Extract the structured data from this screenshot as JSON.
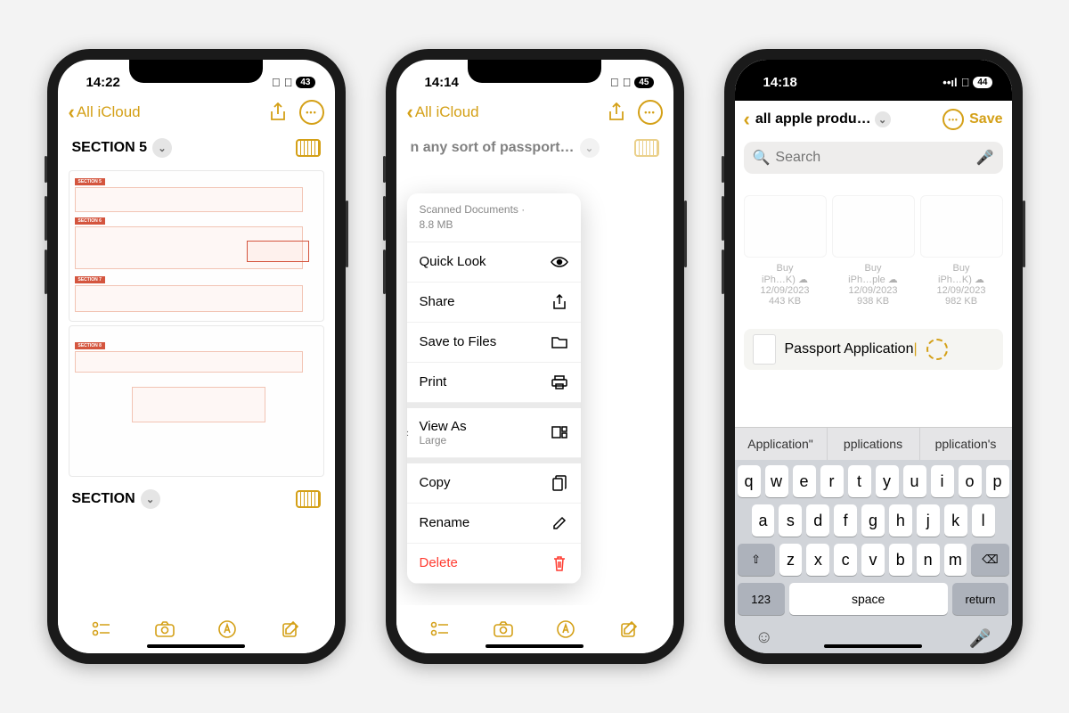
{
  "phone1": {
    "status": {
      "time": "14:22",
      "battery": "43"
    },
    "nav": {
      "back_label": "All iCloud"
    },
    "sections": [
      {
        "title": "SECTION 5"
      },
      {
        "title": "SECTION"
      }
    ]
  },
  "phone2": {
    "status": {
      "time": "14:14",
      "battery": "45"
    },
    "nav": {
      "back_label": "All iCloud"
    },
    "note_title": "n any sort of passport…",
    "popover": {
      "header_title": "Scanned Documents ·",
      "header_size": "8.8 MB",
      "items": [
        {
          "label": "Quick Look",
          "icon": "eye"
        },
        {
          "label": "Share",
          "icon": "share"
        },
        {
          "label": "Save to Files",
          "icon": "folder"
        },
        {
          "label": "Print",
          "icon": "printer"
        },
        {
          "label": "View As",
          "sub": "Large",
          "icon": "grid",
          "submenu": true
        },
        {
          "label": "Copy",
          "icon": "copy"
        },
        {
          "label": "Rename",
          "icon": "pencil"
        },
        {
          "label": "Delete",
          "icon": "trash",
          "destructive": true
        }
      ]
    }
  },
  "phone3": {
    "status": {
      "time": "14:18",
      "battery": "44"
    },
    "nav": {
      "title": "all apple produ…",
      "save": "Save"
    },
    "search_placeholder": "Search",
    "files": [
      {
        "name": "Buy",
        "sub": "iPh…K)",
        "date": "12/09/2023",
        "size": "443 KB"
      },
      {
        "name": "Buy",
        "sub": "iPh…ple",
        "date": "12/09/2023",
        "size": "938 KB"
      },
      {
        "name": "Buy",
        "sub": "iPh…K)",
        "date": "12/09/2023",
        "size": "982 KB"
      }
    ],
    "rename_value": "Passport Application",
    "suggestions": [
      "Application\"",
      "pplications",
      "pplication's"
    ],
    "keyboard": {
      "row1": [
        "q",
        "w",
        "e",
        "r",
        "t",
        "y",
        "u",
        "i",
        "o",
        "p"
      ],
      "row2": [
        "a",
        "s",
        "d",
        "f",
        "g",
        "h",
        "j",
        "k",
        "l"
      ],
      "row3": [
        "z",
        "x",
        "c",
        "v",
        "b",
        "n",
        "m"
      ],
      "num_key": "123",
      "space": "space",
      "return": "return"
    }
  }
}
